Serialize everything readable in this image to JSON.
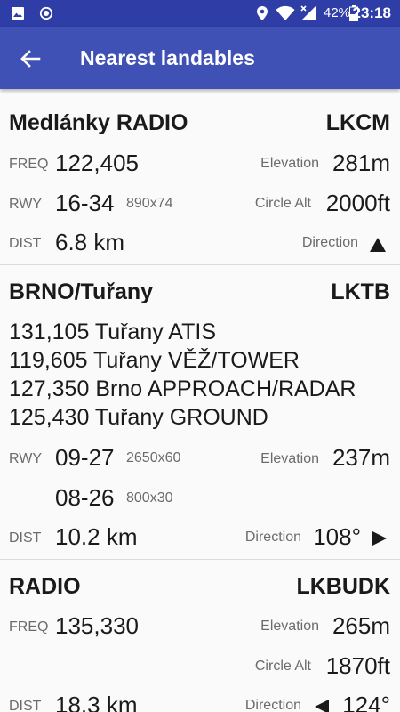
{
  "status_bar": {
    "battery": "42%",
    "time": "23:18"
  },
  "app_bar": {
    "title": "Nearest landables"
  },
  "landables": [
    {
      "name": "Medlánky RADIO",
      "code": "LKCM",
      "freq_label": "FREQ",
      "freq": "122,405",
      "elevation_label": "Elevation",
      "elevation": "281m",
      "rwy_label": "RWY",
      "rwy": "16-34",
      "rwy_dim": "890x74",
      "circle_label": "Circle Alt",
      "circle_alt": "2000ft",
      "dist_label": "DIST",
      "dist": "6.8 km",
      "direction_label": "Direction",
      "direction_icon": "arrow-up-icon"
    },
    {
      "name": "BRNO/Tuřany",
      "code": "LKTB",
      "freqs": [
        "131,105 Tuřany ATIS",
        "119,605 Tuřany VĚŽ/TOWER",
        "127,350 Brno APPROACH/RADAR",
        "125,430 Tuřany GROUND"
      ],
      "rwy_label": "RWY",
      "rwy1": "09-27",
      "rwy1_dim": "2650x60",
      "rwy2": "08-26",
      "rwy2_dim": "800x30",
      "elevation_label": "Elevation",
      "elevation": "237m",
      "dist_label": "DIST",
      "dist": "10.2 km",
      "direction_label": "Direction",
      "direction": "108°",
      "direction_icon": "arrow-right-icon"
    },
    {
      "name": "RADIO",
      "code": "LKBUDK",
      "freq_label": "FREQ",
      "freq": "135,330",
      "elevation_label": "Elevation",
      "elevation": "265m",
      "circle_label": "Circle Alt",
      "circle_alt": "1870ft",
      "dist_label": "DIST",
      "dist": "18.3 km",
      "direction_label": "Direction",
      "direction": "124°",
      "direction_icon": "arrow-left-icon"
    }
  ]
}
